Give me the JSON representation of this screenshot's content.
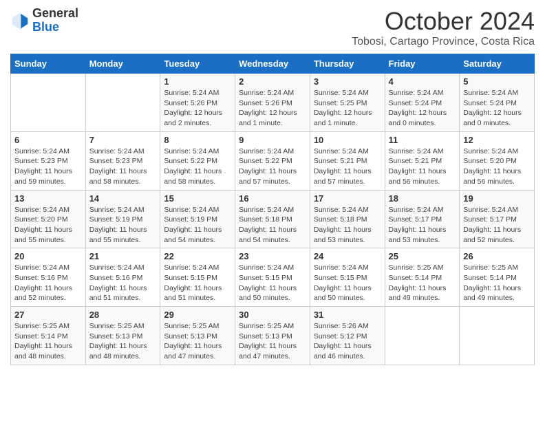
{
  "logo": {
    "general": "General",
    "blue": "Blue"
  },
  "header": {
    "month_title": "October 2024",
    "subtitle": "Tobosi, Cartago Province, Costa Rica"
  },
  "days_of_week": [
    "Sunday",
    "Monday",
    "Tuesday",
    "Wednesday",
    "Thursday",
    "Friday",
    "Saturday"
  ],
  "weeks": [
    [
      {
        "day": "",
        "info": ""
      },
      {
        "day": "",
        "info": ""
      },
      {
        "day": "1",
        "info": "Sunrise: 5:24 AM\nSunset: 5:26 PM\nDaylight: 12 hours and 2 minutes."
      },
      {
        "day": "2",
        "info": "Sunrise: 5:24 AM\nSunset: 5:26 PM\nDaylight: 12 hours and 1 minute."
      },
      {
        "day": "3",
        "info": "Sunrise: 5:24 AM\nSunset: 5:25 PM\nDaylight: 12 hours and 1 minute."
      },
      {
        "day": "4",
        "info": "Sunrise: 5:24 AM\nSunset: 5:24 PM\nDaylight: 12 hours and 0 minutes."
      },
      {
        "day": "5",
        "info": "Sunrise: 5:24 AM\nSunset: 5:24 PM\nDaylight: 12 hours and 0 minutes."
      }
    ],
    [
      {
        "day": "6",
        "info": "Sunrise: 5:24 AM\nSunset: 5:23 PM\nDaylight: 11 hours and 59 minutes."
      },
      {
        "day": "7",
        "info": "Sunrise: 5:24 AM\nSunset: 5:23 PM\nDaylight: 11 hours and 58 minutes."
      },
      {
        "day": "8",
        "info": "Sunrise: 5:24 AM\nSunset: 5:22 PM\nDaylight: 11 hours and 58 minutes."
      },
      {
        "day": "9",
        "info": "Sunrise: 5:24 AM\nSunset: 5:22 PM\nDaylight: 11 hours and 57 minutes."
      },
      {
        "day": "10",
        "info": "Sunrise: 5:24 AM\nSunset: 5:21 PM\nDaylight: 11 hours and 57 minutes."
      },
      {
        "day": "11",
        "info": "Sunrise: 5:24 AM\nSunset: 5:21 PM\nDaylight: 11 hours and 56 minutes."
      },
      {
        "day": "12",
        "info": "Sunrise: 5:24 AM\nSunset: 5:20 PM\nDaylight: 11 hours and 56 minutes."
      }
    ],
    [
      {
        "day": "13",
        "info": "Sunrise: 5:24 AM\nSunset: 5:20 PM\nDaylight: 11 hours and 55 minutes."
      },
      {
        "day": "14",
        "info": "Sunrise: 5:24 AM\nSunset: 5:19 PM\nDaylight: 11 hours and 55 minutes."
      },
      {
        "day": "15",
        "info": "Sunrise: 5:24 AM\nSunset: 5:19 PM\nDaylight: 11 hours and 54 minutes."
      },
      {
        "day": "16",
        "info": "Sunrise: 5:24 AM\nSunset: 5:18 PM\nDaylight: 11 hours and 54 minutes."
      },
      {
        "day": "17",
        "info": "Sunrise: 5:24 AM\nSunset: 5:18 PM\nDaylight: 11 hours and 53 minutes."
      },
      {
        "day": "18",
        "info": "Sunrise: 5:24 AM\nSunset: 5:17 PM\nDaylight: 11 hours and 53 minutes."
      },
      {
        "day": "19",
        "info": "Sunrise: 5:24 AM\nSunset: 5:17 PM\nDaylight: 11 hours and 52 minutes."
      }
    ],
    [
      {
        "day": "20",
        "info": "Sunrise: 5:24 AM\nSunset: 5:16 PM\nDaylight: 11 hours and 52 minutes."
      },
      {
        "day": "21",
        "info": "Sunrise: 5:24 AM\nSunset: 5:16 PM\nDaylight: 11 hours and 51 minutes."
      },
      {
        "day": "22",
        "info": "Sunrise: 5:24 AM\nSunset: 5:15 PM\nDaylight: 11 hours and 51 minutes."
      },
      {
        "day": "23",
        "info": "Sunrise: 5:24 AM\nSunset: 5:15 PM\nDaylight: 11 hours and 50 minutes."
      },
      {
        "day": "24",
        "info": "Sunrise: 5:24 AM\nSunset: 5:15 PM\nDaylight: 11 hours and 50 minutes."
      },
      {
        "day": "25",
        "info": "Sunrise: 5:25 AM\nSunset: 5:14 PM\nDaylight: 11 hours and 49 minutes."
      },
      {
        "day": "26",
        "info": "Sunrise: 5:25 AM\nSunset: 5:14 PM\nDaylight: 11 hours and 49 minutes."
      }
    ],
    [
      {
        "day": "27",
        "info": "Sunrise: 5:25 AM\nSunset: 5:14 PM\nDaylight: 11 hours and 48 minutes."
      },
      {
        "day": "28",
        "info": "Sunrise: 5:25 AM\nSunset: 5:13 PM\nDaylight: 11 hours and 48 minutes."
      },
      {
        "day": "29",
        "info": "Sunrise: 5:25 AM\nSunset: 5:13 PM\nDaylight: 11 hours and 47 minutes."
      },
      {
        "day": "30",
        "info": "Sunrise: 5:25 AM\nSunset: 5:13 PM\nDaylight: 11 hours and 47 minutes."
      },
      {
        "day": "31",
        "info": "Sunrise: 5:26 AM\nSunset: 5:12 PM\nDaylight: 11 hours and 46 minutes."
      },
      {
        "day": "",
        "info": ""
      },
      {
        "day": "",
        "info": ""
      }
    ]
  ]
}
